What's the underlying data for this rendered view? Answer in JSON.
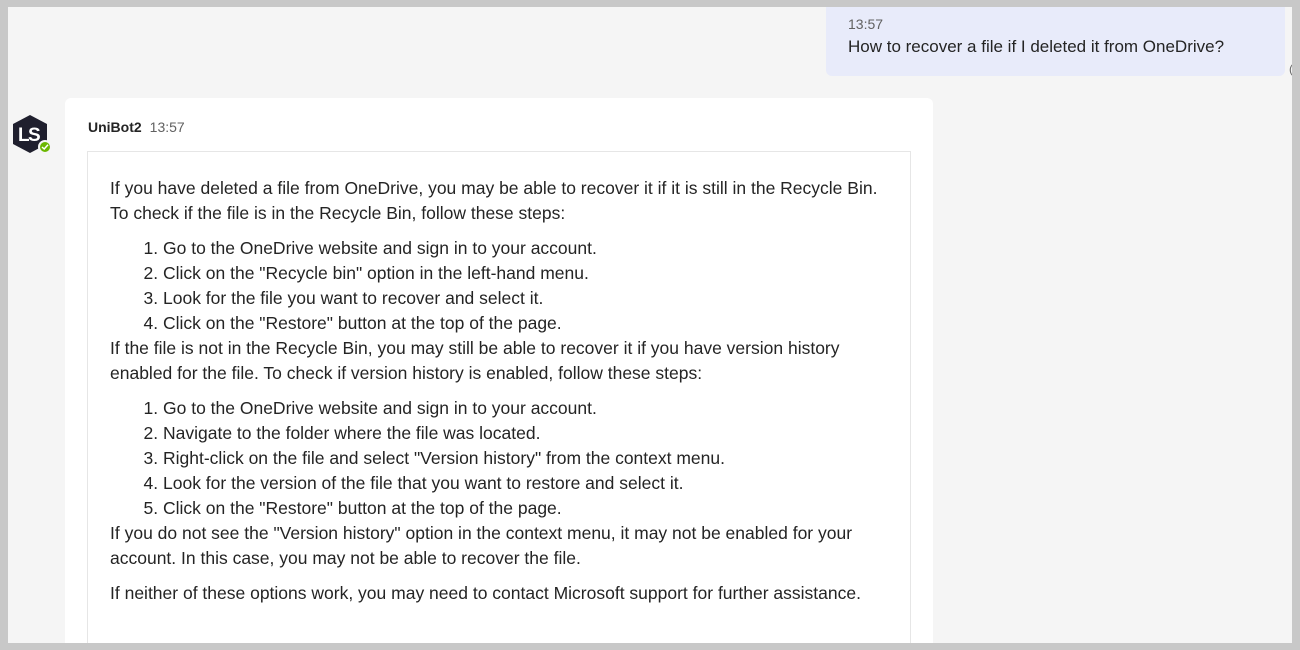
{
  "user_message": {
    "time": "13:57",
    "text": "How to recover a file if I deleted it from OneDrive?"
  },
  "bot": {
    "avatar_icon": "ls-logo-icon",
    "status_color": "#6bb700",
    "name": "UniBot2",
    "time": "13:57"
  },
  "answer": {
    "intro": "If you have deleted a file from OneDrive, you may be able to recover it if it is still in the Recycle Bin. To check if the file is in the Recycle Bin, follow these steps:",
    "steps_recycle": [
      "Go to the OneDrive website and sign in to your account.",
      "Click on the \"Recycle bin\" option in the left-hand menu.",
      "Look for the file you want to recover and select it.",
      "Click on the \"Restore\" button at the top of the page."
    ],
    "version_intro": "If the file is not in the Recycle Bin, you may still be able to recover it if you have version history enabled for the file. To check if version history is enabled, follow these steps:",
    "steps_version": [
      "Go to the OneDrive website and sign in to your account.",
      "Navigate to the folder where the file was located.",
      "Right-click on the file and select \"Version history\" from the context menu.",
      "Look for the version of the file that you want to restore and select it.",
      "Click on the \"Restore\" button at the top of the page."
    ],
    "no_version": "If you do not see the \"Version history\" option in the context menu, it may not be enabled for your account. In this case, you may not be able to recover the file.",
    "closing": "If neither of these options work, you may need to contact Microsoft support for further assistance."
  }
}
